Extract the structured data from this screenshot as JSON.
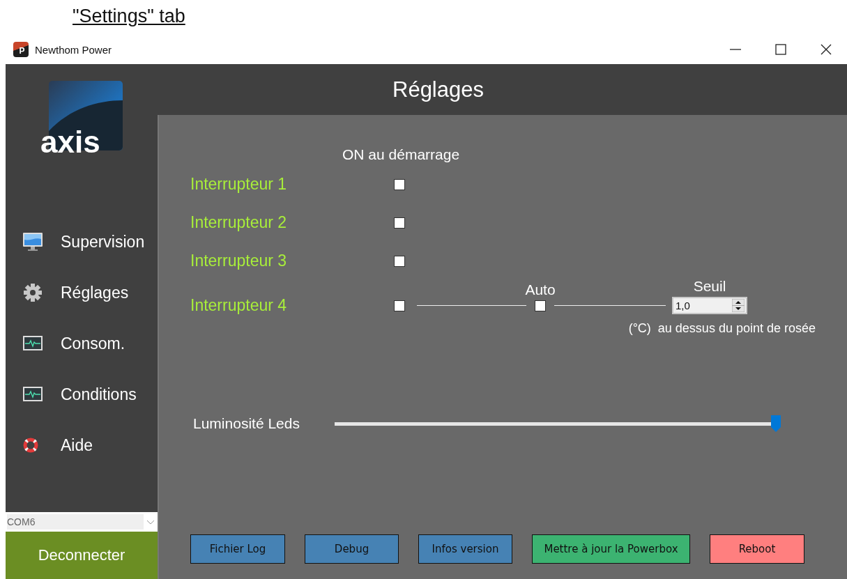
{
  "document_heading": "\"Settings\" tab",
  "window": {
    "icon_letter": "P",
    "title": "Newthom Power"
  },
  "sidebar": {
    "logo_text": "axis",
    "items": [
      {
        "label": "Supervision",
        "kind": "monitor"
      },
      {
        "label": "Réglages",
        "kind": "gear"
      },
      {
        "label": "Consom.",
        "kind": "pulse"
      },
      {
        "label": "Conditions",
        "kind": "pulse"
      },
      {
        "label": "Aide",
        "kind": "lifebuoy"
      }
    ],
    "port_select": {
      "value": "COM6"
    },
    "connect_button": "Deconnecter"
  },
  "header": {
    "title": "Réglages"
  },
  "switches": {
    "column_heading": "ON au démarrage",
    "rows": [
      {
        "label": "Interrupteur 1",
        "checked": false
      },
      {
        "label": "Interrupteur 2",
        "checked": false
      },
      {
        "label": "Interrupteur 3",
        "checked": false
      },
      {
        "label": "Interrupteur 4",
        "checked": false,
        "auto": {
          "label": "Auto",
          "checked": false
        },
        "threshold": {
          "label": "Seuil",
          "value": "1,0",
          "note": "(°C)  au dessus du point de rosée"
        }
      }
    ]
  },
  "brightness": {
    "label": "Luminosité Leds",
    "level": 1.0
  },
  "buttons": [
    {
      "label": "Fichier Log",
      "color": "#4682b4"
    },
    {
      "label": "Debug",
      "color": "#4682b4"
    },
    {
      "label": "Infos version",
      "color": "#4682b4"
    },
    {
      "label": "Mettre à jour la Powerbox",
      "color": "#3cb371"
    },
    {
      "label": "Reboot",
      "color": "#ff7f7f"
    }
  ]
}
